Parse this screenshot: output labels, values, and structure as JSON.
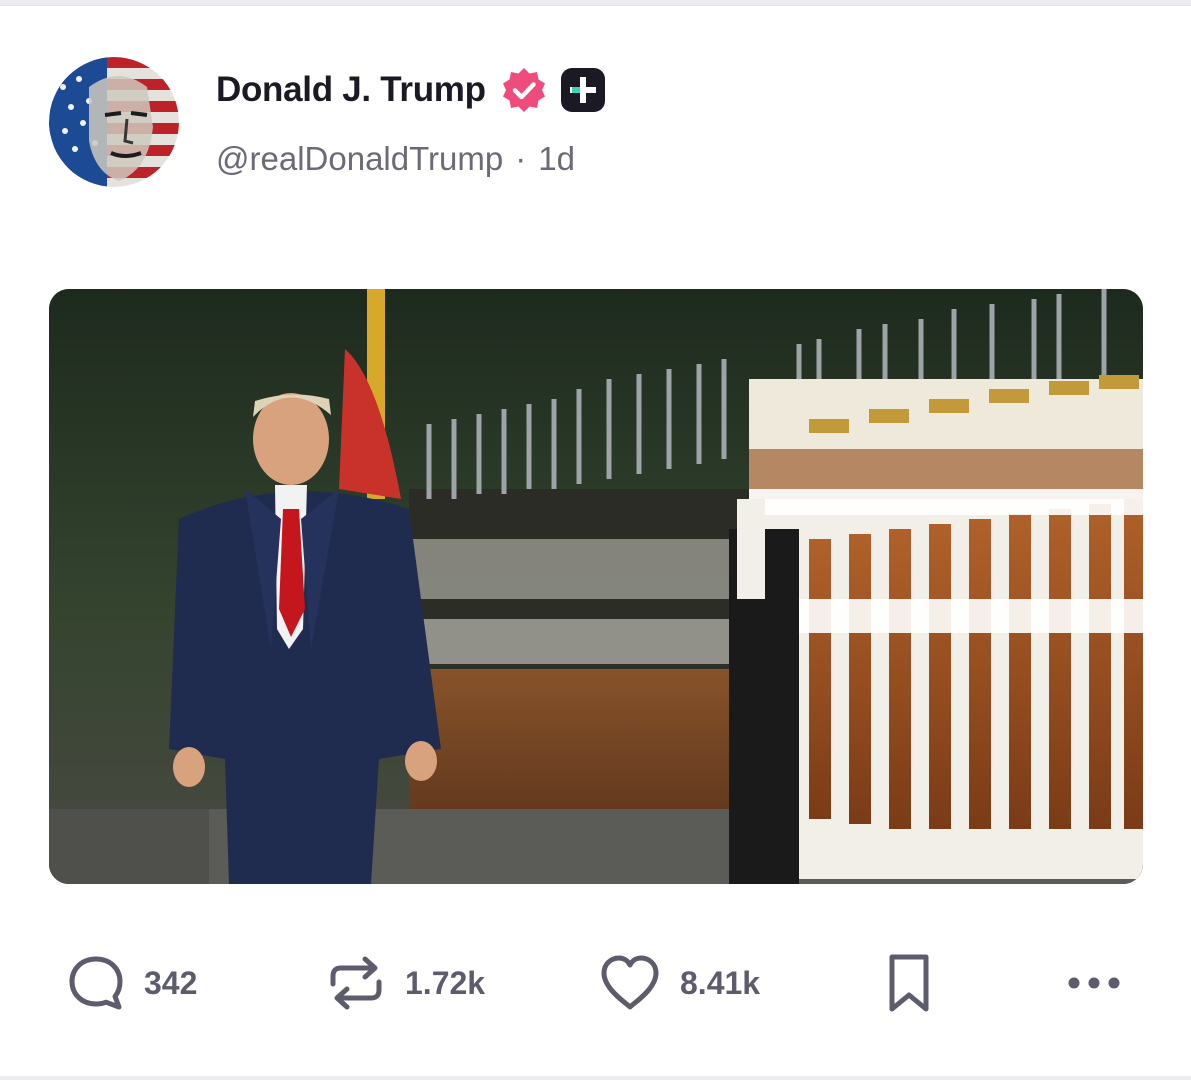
{
  "post": {
    "author": {
      "display_name": "Donald J. Trump",
      "handle": "@realDonaldTrump",
      "verified_badge_icon": "verified-rosette-icon",
      "verified_color": "#ef4b7d",
      "plus_badge_icon": "plus-badge-icon"
    },
    "separator": "·",
    "time_ago": "1d",
    "media": {
      "kind": "photo"
    },
    "actions": {
      "reply": {
        "icon": "speech-bubble-icon",
        "count": "342"
      },
      "repost": {
        "icon": "repost-arrows-icon",
        "count": "1.72k"
      },
      "like": {
        "icon": "heart-icon",
        "count": "8.41k"
      },
      "bookmark": {
        "icon": "bookmark-icon"
      },
      "more": {
        "icon": "more-dots-icon"
      }
    }
  },
  "colors": {
    "text_primary": "#1b1a24",
    "text_secondary": "#6b6a78",
    "icon_gray": "#5d5c6c"
  }
}
